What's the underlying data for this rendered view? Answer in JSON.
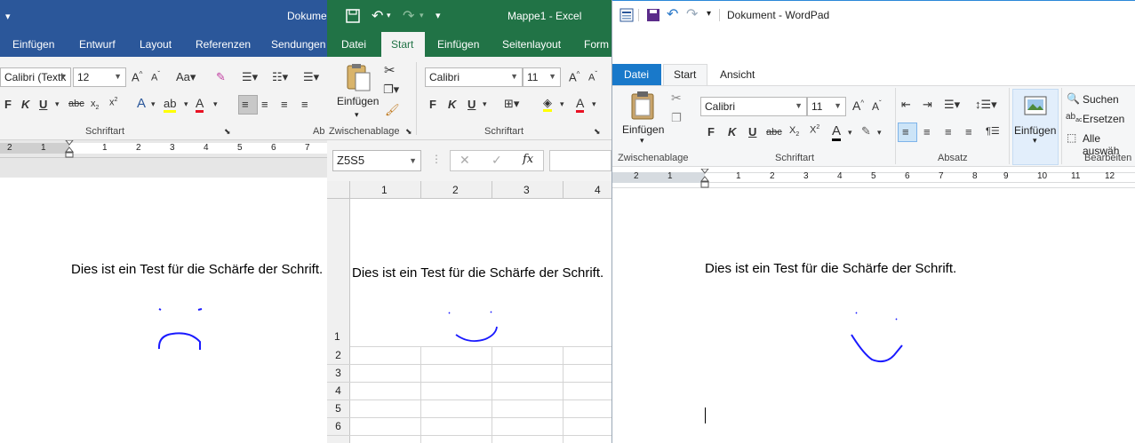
{
  "word": {
    "title": "Dokume",
    "tabs": [
      "Einfügen",
      "Entwurf",
      "Layout",
      "Referenzen",
      "Sendungen"
    ],
    "font_name": "Calibri (Textk",
    "font_size": "12",
    "group_font": "Schriftart",
    "group_paragraph": "Ab",
    "ruler_numbers": [
      "2",
      "1",
      "1",
      "2",
      "3",
      "4",
      "5",
      "6",
      "7"
    ],
    "body_text": "Dies ist ein Test für die Schärfe der Schrift.",
    "accent": "#2b579a"
  },
  "excel": {
    "title": "Mappe1  -  Excel",
    "tabs": [
      "Datei",
      "Start",
      "Einfügen",
      "Seitenlayout",
      "Form"
    ],
    "paste_label": "Einfügen",
    "group_clipboard": "Zwischenablage",
    "group_font": "Schriftart",
    "font_name": "Calibri",
    "font_size": "11",
    "name_box": "Z5S5",
    "fx_label": "fx",
    "col_headers": [
      "1",
      "2",
      "3",
      "4"
    ],
    "row_headers": [
      "1",
      "2",
      "3",
      "4",
      "5",
      "6"
    ],
    "cell_text": "Dies ist ein Test für die Schärfe der Schrift.",
    "accent": "#217346"
  },
  "wordpad": {
    "title": "Dokument - WordPad",
    "tabs": [
      "Datei",
      "Start",
      "Ansicht"
    ],
    "paste_label": "Einfügen",
    "group_clipboard": "Zwischenablage",
    "group_font": "Schriftart",
    "group_paragraph": "Absatz",
    "group_edit": "Bearbeiten",
    "font_name": "Calibri",
    "font_size": "11",
    "insert_label": "Einfügen",
    "search_label": "Suchen",
    "replace_label": "Ersetzen",
    "select_all_label": "Alle auswäh",
    "ruler_numbers": [
      "2",
      "1",
      "1",
      "2",
      "3",
      "4",
      "5",
      "6",
      "7",
      "8",
      "9",
      "10",
      "11",
      "12"
    ],
    "body_text": "Dies ist ein Test für die Schärfe der Schrift.",
    "accent": "#2b88d8"
  },
  "ink_color": "#1a1aff"
}
